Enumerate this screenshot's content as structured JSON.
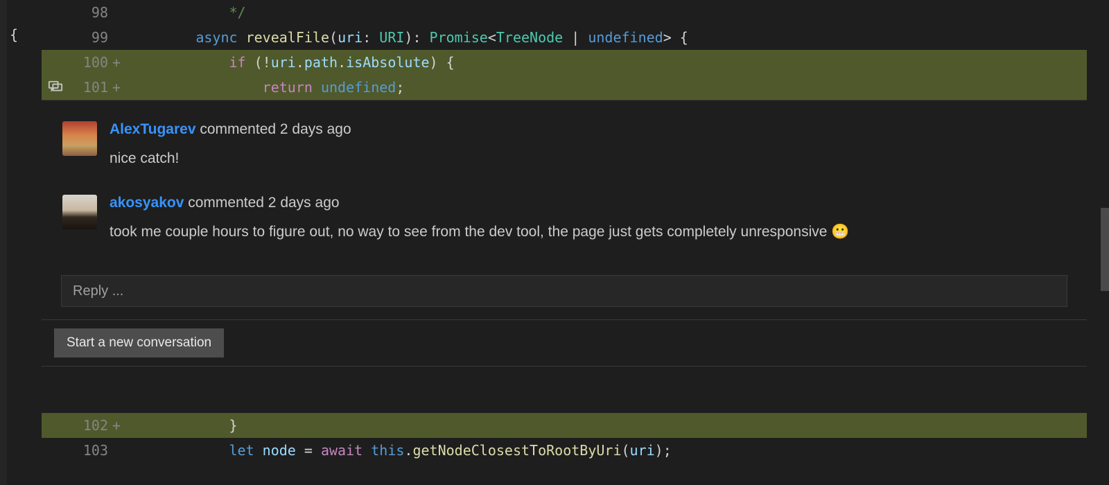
{
  "code": {
    "lines": [
      {
        "num": "98",
        "added": false,
        "plus": "",
        "tokens": [
          {
            "cls": "tok-comment",
            "text": "            */"
          }
        ]
      },
      {
        "num": "99",
        "added": false,
        "plus": "",
        "tokens": [
          {
            "cls": "",
            "text": "        "
          },
          {
            "cls": "tok-kw",
            "text": "async"
          },
          {
            "cls": "",
            "text": " "
          },
          {
            "cls": "tok-fn",
            "text": "revealFile"
          },
          {
            "cls": "tok-punc",
            "text": "("
          },
          {
            "cls": "tok-var",
            "text": "uri"
          },
          {
            "cls": "tok-punc",
            "text": ": "
          },
          {
            "cls": "tok-type",
            "text": "URI"
          },
          {
            "cls": "tok-punc",
            "text": "): "
          },
          {
            "cls": "tok-type",
            "text": "Promise"
          },
          {
            "cls": "tok-punc",
            "text": "<"
          },
          {
            "cls": "tok-type",
            "text": "TreeNode"
          },
          {
            "cls": "tok-punc",
            "text": " | "
          },
          {
            "cls": "tok-kw",
            "text": "undefined"
          },
          {
            "cls": "tok-punc",
            "text": "> {"
          }
        ]
      },
      {
        "num": "100",
        "added": true,
        "plus": "+",
        "tokens": [
          {
            "cls": "",
            "text": "            "
          },
          {
            "cls": "tok-ctrl",
            "text": "if"
          },
          {
            "cls": "tok-punc",
            "text": " (!"
          },
          {
            "cls": "tok-var",
            "text": "uri"
          },
          {
            "cls": "tok-punc",
            "text": "."
          },
          {
            "cls": "tok-var",
            "text": "path"
          },
          {
            "cls": "tok-punc",
            "text": "."
          },
          {
            "cls": "tok-var",
            "text": "isAbsolute"
          },
          {
            "cls": "tok-punc",
            "text": ") {"
          }
        ]
      },
      {
        "num": "101",
        "added": true,
        "plus": "+",
        "icon": "comment",
        "tokens": [
          {
            "cls": "",
            "text": "                "
          },
          {
            "cls": "tok-ctrl",
            "text": "return"
          },
          {
            "cls": "",
            "text": " "
          },
          {
            "cls": "tok-kw",
            "text": "undefined"
          },
          {
            "cls": "tok-punc",
            "text": ";"
          }
        ]
      }
    ],
    "bottom_lines": [
      {
        "num": "102",
        "added": true,
        "plus": "+",
        "tokens": [
          {
            "cls": "",
            "text": "            "
          },
          {
            "cls": "tok-punc",
            "text": "}"
          }
        ]
      },
      {
        "num": "103",
        "added": false,
        "plus": "",
        "tokens": [
          {
            "cls": "",
            "text": "            "
          },
          {
            "cls": "tok-kw",
            "text": "let"
          },
          {
            "cls": "",
            "text": " "
          },
          {
            "cls": "tok-var",
            "text": "node"
          },
          {
            "cls": "",
            "text": " = "
          },
          {
            "cls": "tok-ctrl",
            "text": "await"
          },
          {
            "cls": "",
            "text": " "
          },
          {
            "cls": "tok-kw",
            "text": "this"
          },
          {
            "cls": "tok-punc",
            "text": "."
          },
          {
            "cls": "tok-fn",
            "text": "getNodeClosestToRootByUri"
          },
          {
            "cls": "tok-punc",
            "text": "("
          },
          {
            "cls": "tok-var",
            "text": "uri"
          },
          {
            "cls": "tok-punc",
            "text": ");"
          }
        ]
      }
    ],
    "left_brace": "{"
  },
  "thread": {
    "comments": [
      {
        "author": "AlexTugarev",
        "meta": " commented 2 days ago",
        "body": "nice catch!"
      },
      {
        "author": "akosyakov",
        "meta": " commented 2 days ago",
        "body": "took me couple hours to figure out, no way to see from the dev tool, the page just gets completely unresponsive 😬"
      }
    ],
    "reply_placeholder": "Reply ...",
    "new_conversation_label": "Start a new conversation"
  }
}
